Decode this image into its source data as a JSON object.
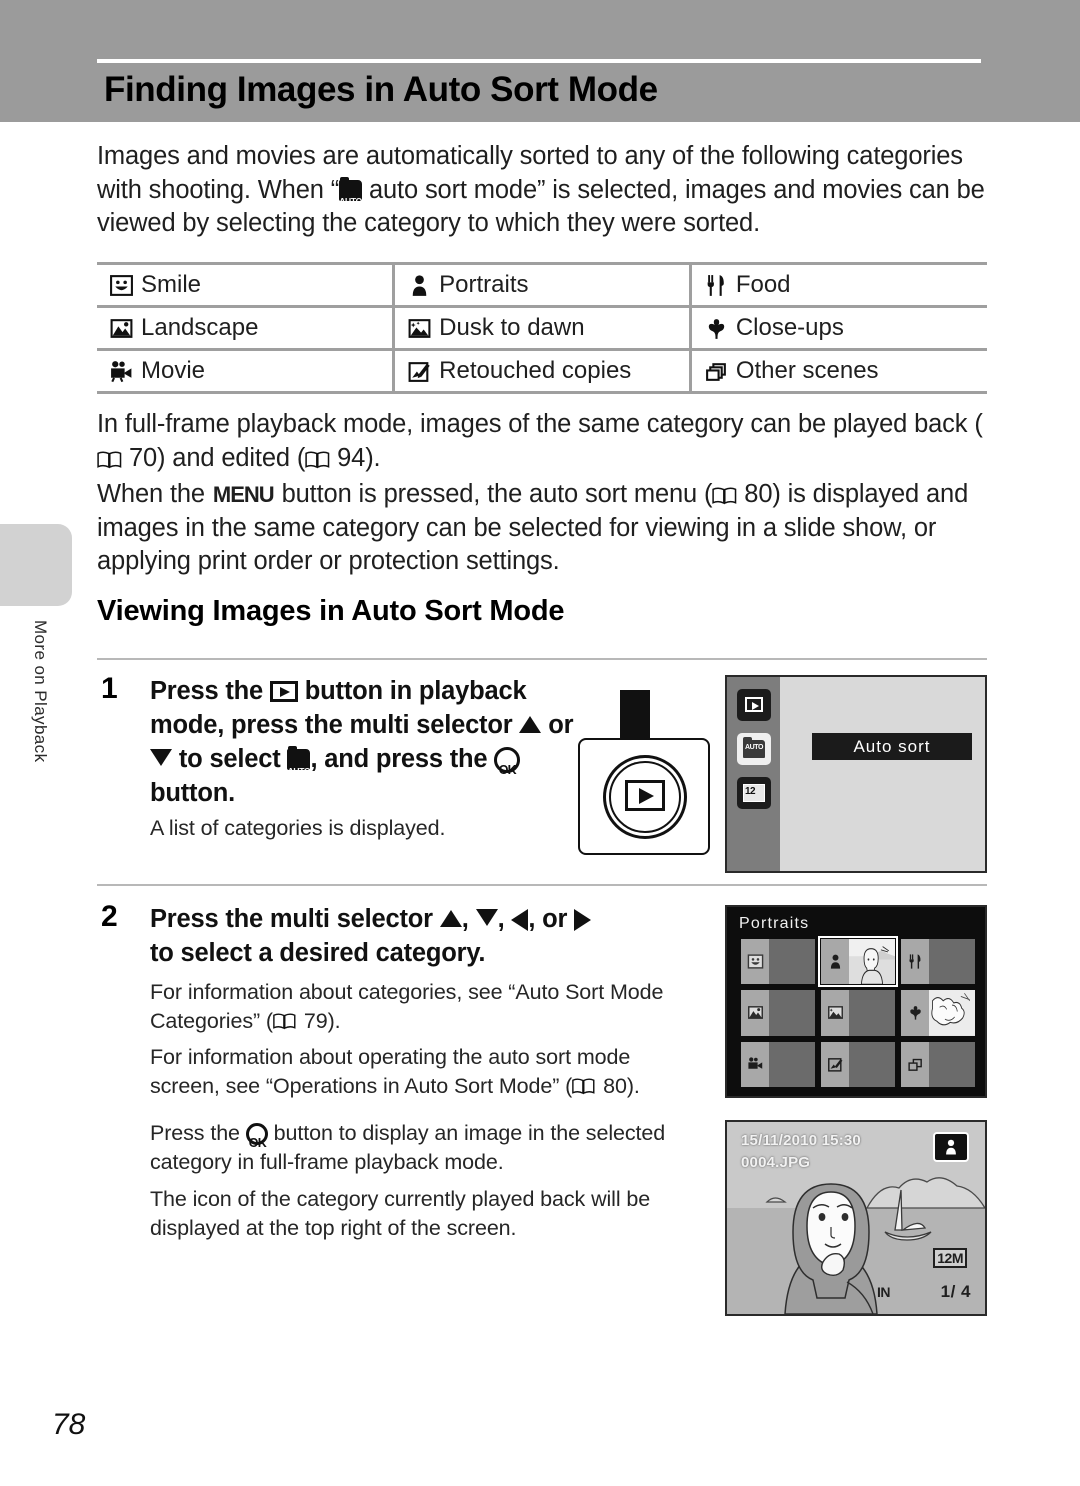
{
  "page": {
    "number": "78",
    "side_tab": "More on Playback",
    "title": "Finding Images in Auto Sort Mode"
  },
  "intro": {
    "part1": "Images and movies are automatically sorted to any of the following categories with shooting. When “",
    "icon": "auto-sort-folder-icon",
    "part2": " auto sort mode” is selected, images and movies can be viewed by selecting the category to which they were sorted."
  },
  "categories_table": {
    "rows": [
      [
        {
          "icon": "smile-icon",
          "label": "Smile"
        },
        {
          "icon": "portraits-icon",
          "label": "Portraits"
        },
        {
          "icon": "food-icon",
          "label": "Food"
        }
      ],
      [
        {
          "icon": "landscape-icon",
          "label": "Landscape"
        },
        {
          "icon": "dusk-to-dawn-icon",
          "label": "Dusk to dawn"
        },
        {
          "icon": "close-ups-icon",
          "label": "Close-ups"
        }
      ],
      [
        {
          "icon": "movie-icon",
          "label": "Movie"
        },
        {
          "icon": "retouched-copies-icon",
          "label": "Retouched copies"
        },
        {
          "icon": "other-scenes-icon",
          "label": "Other scenes"
        }
      ]
    ]
  },
  "body": {
    "p2_a": "In full-frame playback mode, images of the same category can be played back (",
    "p2_ref1": "70",
    "p2_b": ") and edited (",
    "p2_ref2": "94",
    "p2_c": ").",
    "p3_a": "When the ",
    "p3_menu": "MENU",
    "p3_b": " button is pressed, the auto sort menu (",
    "p3_ref": "80",
    "p3_c": ") is displayed and images in the same category can be selected for viewing in a slide show, or applying print order or protection settings."
  },
  "section": {
    "heading": "Viewing Images in Auto Sort Mode"
  },
  "steps": [
    {
      "number": "1",
      "head_a": "Press the ",
      "head_b": " button in playback mode, press the multi selector ",
      "head_c": " or ",
      "head_d": " to select ",
      "head_e": ", and press the ",
      "head_f": " button.",
      "body": "A list of categories is displayed."
    },
    {
      "number": "2",
      "head_a": "Press the multi selector ",
      "head_b": ", ",
      "head_c": ", ",
      "head_d": ", or ",
      "head_e": " to select a desired category.",
      "body1_a": "For information about categories, see “Auto Sort Mode Categories” (",
      "body1_ref": "79",
      "body1_b": ").",
      "body2_a": "For information about operating the auto sort mode screen, see “Operations in Auto Sort Mode” (",
      "body2_ref": "80",
      "body2_b": ").",
      "body3_a": "Press the ",
      "body3_b": " button to display an image in the selected category in full-frame playback mode.",
      "body4": "The icon of the category currently played back will be displayed at the top right of the screen."
    }
  ],
  "screens": {
    "mode_menu": {
      "selected_label": "Auto sort",
      "icons": [
        "playback-mode-icon",
        "auto-sort-mode-icon",
        "list-by-date-mode-icon"
      ]
    },
    "category_grid": {
      "title": "Portraits",
      "cells": [
        {
          "icon": "smile-icon",
          "selected": false,
          "has_thumb": false
        },
        {
          "icon": "portraits-icon",
          "selected": true,
          "has_thumb": true
        },
        {
          "icon": "food-icon",
          "selected": false,
          "has_thumb": false
        },
        {
          "icon": "landscape-icon",
          "selected": false,
          "has_thumb": false
        },
        {
          "icon": "dusk-to-dawn-icon",
          "selected": false,
          "has_thumb": false
        },
        {
          "icon": "close-ups-icon",
          "selected": false,
          "has_thumb": true
        },
        {
          "icon": "movie-icon",
          "selected": false,
          "has_thumb": false
        },
        {
          "icon": "retouched-copies-icon",
          "selected": false,
          "has_thumb": false
        },
        {
          "icon": "other-scenes-icon",
          "selected": false,
          "has_thumb": false
        }
      ]
    },
    "playback": {
      "datetime": "15/11/2010 15:30",
      "filename": "0004.JPG",
      "badge_icon": "portraits-icon",
      "image_size": "12M",
      "memory": "IN",
      "counter": "1/  4"
    }
  },
  "colors": {
    "header_band": "#9b9b9b",
    "rule": "#9f9f9f",
    "text": "#1f1f1f"
  }
}
